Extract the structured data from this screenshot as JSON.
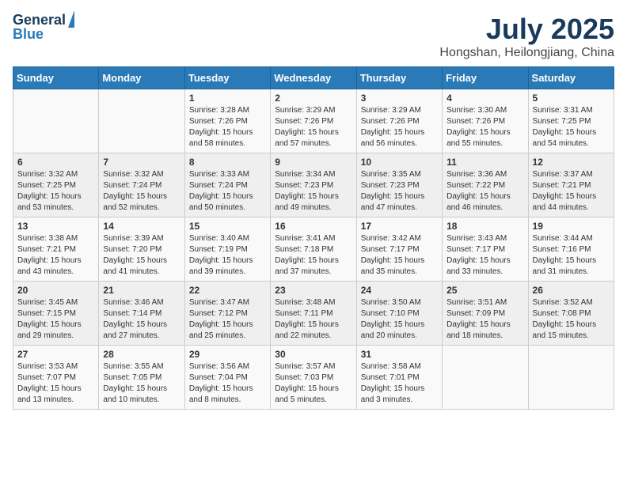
{
  "header": {
    "logo_line1": "General",
    "logo_line2": "Blue",
    "month": "July 2025",
    "location": "Hongshan, Heilongjiang, China"
  },
  "weekdays": [
    "Sunday",
    "Monday",
    "Tuesday",
    "Wednesday",
    "Thursday",
    "Friday",
    "Saturday"
  ],
  "weeks": [
    [
      {
        "day": "",
        "info": ""
      },
      {
        "day": "",
        "info": ""
      },
      {
        "day": "1",
        "info": "Sunrise: 3:28 AM\nSunset: 7:26 PM\nDaylight: 15 hours\nand 58 minutes."
      },
      {
        "day": "2",
        "info": "Sunrise: 3:29 AM\nSunset: 7:26 PM\nDaylight: 15 hours\nand 57 minutes."
      },
      {
        "day": "3",
        "info": "Sunrise: 3:29 AM\nSunset: 7:26 PM\nDaylight: 15 hours\nand 56 minutes."
      },
      {
        "day": "4",
        "info": "Sunrise: 3:30 AM\nSunset: 7:26 PM\nDaylight: 15 hours\nand 55 minutes."
      },
      {
        "day": "5",
        "info": "Sunrise: 3:31 AM\nSunset: 7:25 PM\nDaylight: 15 hours\nand 54 minutes."
      }
    ],
    [
      {
        "day": "6",
        "info": "Sunrise: 3:32 AM\nSunset: 7:25 PM\nDaylight: 15 hours\nand 53 minutes."
      },
      {
        "day": "7",
        "info": "Sunrise: 3:32 AM\nSunset: 7:24 PM\nDaylight: 15 hours\nand 52 minutes."
      },
      {
        "day": "8",
        "info": "Sunrise: 3:33 AM\nSunset: 7:24 PM\nDaylight: 15 hours\nand 50 minutes."
      },
      {
        "day": "9",
        "info": "Sunrise: 3:34 AM\nSunset: 7:23 PM\nDaylight: 15 hours\nand 49 minutes."
      },
      {
        "day": "10",
        "info": "Sunrise: 3:35 AM\nSunset: 7:23 PM\nDaylight: 15 hours\nand 47 minutes."
      },
      {
        "day": "11",
        "info": "Sunrise: 3:36 AM\nSunset: 7:22 PM\nDaylight: 15 hours\nand 46 minutes."
      },
      {
        "day": "12",
        "info": "Sunrise: 3:37 AM\nSunset: 7:21 PM\nDaylight: 15 hours\nand 44 minutes."
      }
    ],
    [
      {
        "day": "13",
        "info": "Sunrise: 3:38 AM\nSunset: 7:21 PM\nDaylight: 15 hours\nand 43 minutes."
      },
      {
        "day": "14",
        "info": "Sunrise: 3:39 AM\nSunset: 7:20 PM\nDaylight: 15 hours\nand 41 minutes."
      },
      {
        "day": "15",
        "info": "Sunrise: 3:40 AM\nSunset: 7:19 PM\nDaylight: 15 hours\nand 39 minutes."
      },
      {
        "day": "16",
        "info": "Sunrise: 3:41 AM\nSunset: 7:18 PM\nDaylight: 15 hours\nand 37 minutes."
      },
      {
        "day": "17",
        "info": "Sunrise: 3:42 AM\nSunset: 7:17 PM\nDaylight: 15 hours\nand 35 minutes."
      },
      {
        "day": "18",
        "info": "Sunrise: 3:43 AM\nSunset: 7:17 PM\nDaylight: 15 hours\nand 33 minutes."
      },
      {
        "day": "19",
        "info": "Sunrise: 3:44 AM\nSunset: 7:16 PM\nDaylight: 15 hours\nand 31 minutes."
      }
    ],
    [
      {
        "day": "20",
        "info": "Sunrise: 3:45 AM\nSunset: 7:15 PM\nDaylight: 15 hours\nand 29 minutes."
      },
      {
        "day": "21",
        "info": "Sunrise: 3:46 AM\nSunset: 7:14 PM\nDaylight: 15 hours\nand 27 minutes."
      },
      {
        "day": "22",
        "info": "Sunrise: 3:47 AM\nSunset: 7:12 PM\nDaylight: 15 hours\nand 25 minutes."
      },
      {
        "day": "23",
        "info": "Sunrise: 3:48 AM\nSunset: 7:11 PM\nDaylight: 15 hours\nand 22 minutes."
      },
      {
        "day": "24",
        "info": "Sunrise: 3:50 AM\nSunset: 7:10 PM\nDaylight: 15 hours\nand 20 minutes."
      },
      {
        "day": "25",
        "info": "Sunrise: 3:51 AM\nSunset: 7:09 PM\nDaylight: 15 hours\nand 18 minutes."
      },
      {
        "day": "26",
        "info": "Sunrise: 3:52 AM\nSunset: 7:08 PM\nDaylight: 15 hours\nand 15 minutes."
      }
    ],
    [
      {
        "day": "27",
        "info": "Sunrise: 3:53 AM\nSunset: 7:07 PM\nDaylight: 15 hours\nand 13 minutes."
      },
      {
        "day": "28",
        "info": "Sunrise: 3:55 AM\nSunset: 7:05 PM\nDaylight: 15 hours\nand 10 minutes."
      },
      {
        "day": "29",
        "info": "Sunrise: 3:56 AM\nSunset: 7:04 PM\nDaylight: 15 hours\nand 8 minutes."
      },
      {
        "day": "30",
        "info": "Sunrise: 3:57 AM\nSunset: 7:03 PM\nDaylight: 15 hours\nand 5 minutes."
      },
      {
        "day": "31",
        "info": "Sunrise: 3:58 AM\nSunset: 7:01 PM\nDaylight: 15 hours\nand 3 minutes."
      },
      {
        "day": "",
        "info": ""
      },
      {
        "day": "",
        "info": ""
      }
    ]
  ]
}
